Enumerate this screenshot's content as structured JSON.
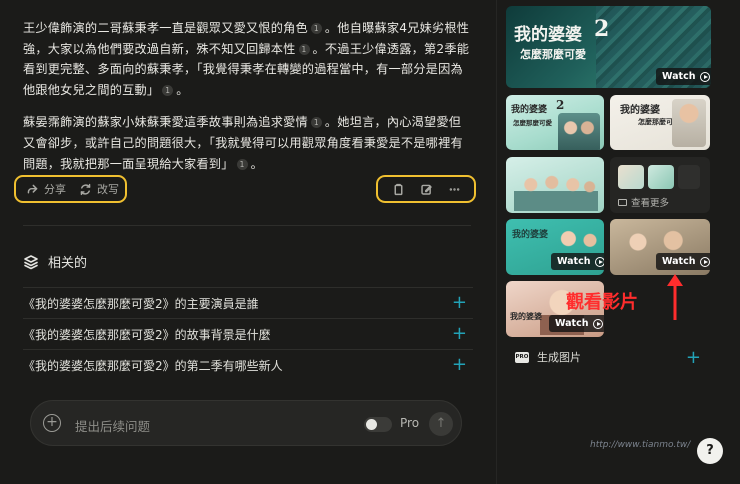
{
  "answer": {
    "p1": {
      "t1": "王少偉飾演的二哥蘇秉孝一直是觀眾又愛又恨的角色",
      "c1": "1",
      "t2": "。他自曝蘇家4兄妹劣根性強，大家以為他們要改過自新，殊不知又回歸本性",
      "c2": "1",
      "t3": "。不過王少偉透露，第2季能看到更完整、多面向的蘇秉孝，「我覺得秉孝在轉變的過程當中，有一部分是因為他跟他女兒之間的互動」",
      "c3": "1",
      "t4": "。"
    },
    "p2": {
      "t1": "蘇晏霈飾演的蘇家小妹蘇秉愛這季故事則為追求愛情",
      "c1": "1",
      "t2": "。她坦言，內心渴望愛但又會卻步，或許自己的問題很大，「我就覺得可以用觀眾角度看秉愛是不是哪裡有問題，我就把那一面呈現給大家看到」",
      "c2": "1",
      "t3": "。"
    }
  },
  "actions": {
    "share_label": "分享",
    "rewrite_label": "改写"
  },
  "related": {
    "heading": "相关的",
    "items": [
      "《我的婆婆怎麼那麼可愛2》的主要演員是誰",
      "《我的婆婆怎麼那麼可愛2》的故事背景是什麼",
      "《我的婆婆怎麼那麼可愛2》的第二季有哪些新人"
    ]
  },
  "followup": {
    "placeholder": "提出后续问题",
    "pro_label": "Pro"
  },
  "media": {
    "watch_label": "Watch",
    "see_more": "查看更多",
    "generate_image": "生成图片",
    "pro_badge": "PRO",
    "poster_title_a": "我的婆婆",
    "poster_title_b": "怎麼那麼可愛",
    "poster_number": "2",
    "annotation": "觀看影片",
    "watermark": "http://www.tianmo.tw/"
  },
  "help_label": "?",
  "colors": {
    "background": "#1b1b19",
    "highlight_box": "#f0c030",
    "accent_plus": "#22a3b8",
    "annotation_red": "#ff2d2d"
  }
}
